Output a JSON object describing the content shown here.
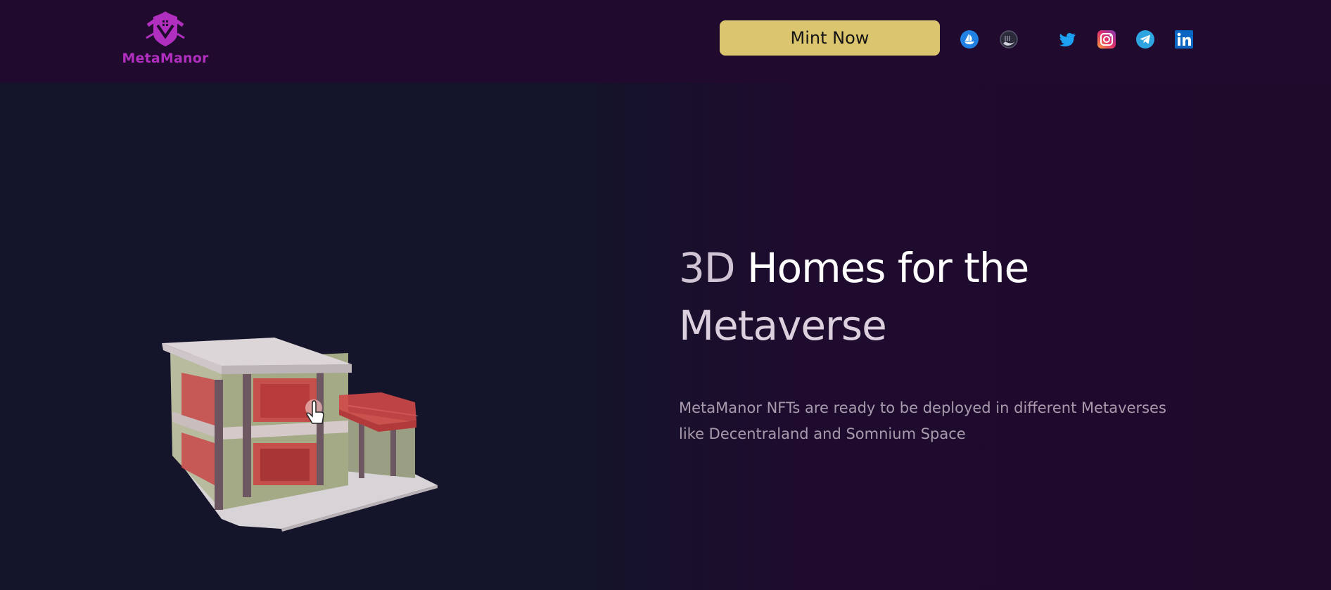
{
  "header": {
    "brand": "MetaManor",
    "mint_label": "Mint Now",
    "social": [
      {
        "icon": "opensea-icon",
        "color": "#2081e2"
      },
      {
        "icon": "moon-icon",
        "color": "#2b2b3a"
      },
      {
        "icon": "twitter-icon",
        "color": "#1da1f2"
      },
      {
        "icon": "instagram-icon",
        "color": "#e1306c"
      },
      {
        "icon": "telegram-icon",
        "color": "#2ea5e0"
      },
      {
        "icon": "linkedin-icon",
        "color": "#0a66c2"
      }
    ]
  },
  "hero": {
    "headline_part_a": "3D",
    "headline_part_b": " Homes for the",
    "headline_part_c": "Metaverse",
    "description": "MetaManor NFTs are ready to be deployed in different Metaverses like Decentraland and Somnium Space"
  },
  "colors": {
    "header_bg": "#200a2e",
    "accent_button": "#dcc56f",
    "brand_purple": "#b12fbf"
  }
}
